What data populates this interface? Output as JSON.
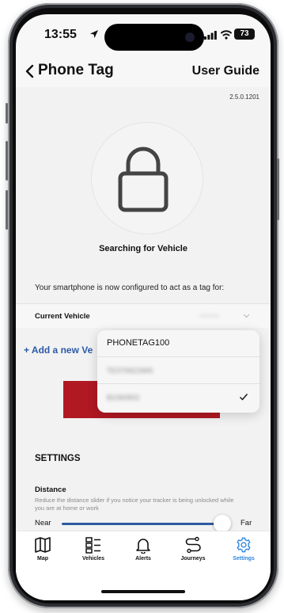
{
  "status_bar": {
    "time": "13:55",
    "battery": "73"
  },
  "nav": {
    "title": "Phone Tag",
    "user_guide": "User Guide"
  },
  "version": "2.5.0.1201",
  "lock_status": "Searching for Vehicle",
  "config_text": "Your smartphone is now configured to act as a tag for:",
  "current_vehicle": {
    "label": "Current Vehicle",
    "value": "•••••••• "
  },
  "add_vehicle": "+ Add a new Ve",
  "dropdown": {
    "items": [
      {
        "label": "PHONETAG100",
        "selected": false
      },
      {
        "label": "TESTINGSMS",
        "selected": false
      },
      {
        "label": "B1060903",
        "selected": true
      }
    ]
  },
  "settings": {
    "heading": "SETTINGS",
    "distance": {
      "label": "Distance",
      "description": "Reduce the distance slider if you notice your tracker is being unlocked while you are at home or work",
      "min_label": "Near",
      "max_label": "Far",
      "level": 0.95
    }
  },
  "tabs": [
    {
      "label": "Map",
      "icon": "map-icon",
      "active": false
    },
    {
      "label": "Vehicles",
      "icon": "vehicles-list-icon",
      "active": false
    },
    {
      "label": "Alerts",
      "icon": "bell-icon",
      "active": false
    },
    {
      "label": "Journeys",
      "icon": "route-icon",
      "active": false
    },
    {
      "label": "Settings",
      "icon": "gear-icon",
      "active": true
    }
  ],
  "colors": {
    "accent_blue": "#2e86de",
    "link_blue": "#2a5aa8",
    "brand_red": "#b01822",
    "slider_blue": "#2c5aa0"
  }
}
